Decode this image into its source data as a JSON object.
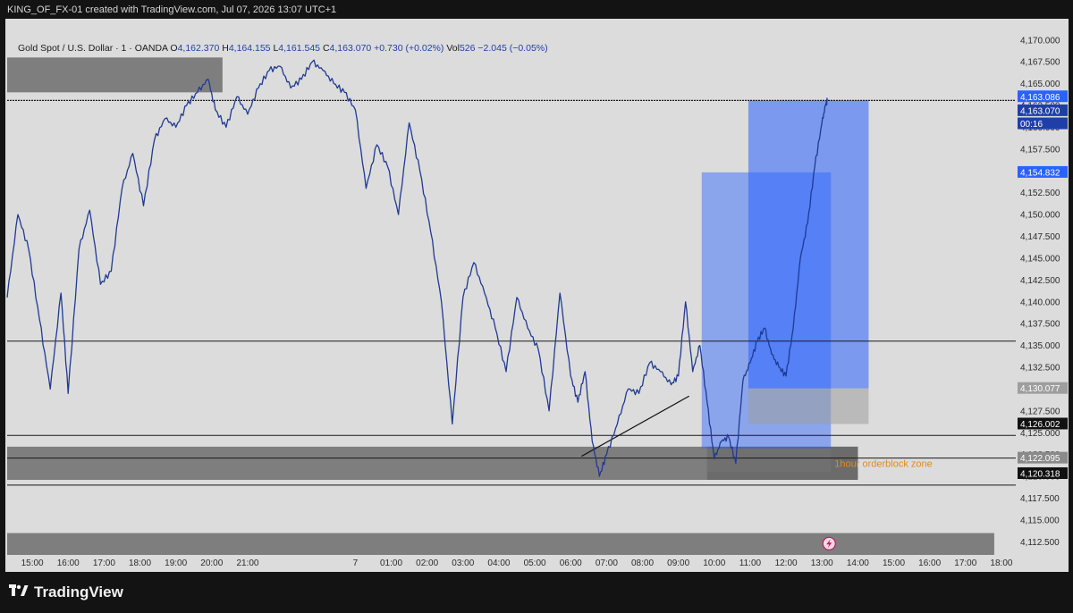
{
  "header": {
    "credit": "KING_OF_FX-01 created with TradingView.com, Jul 07, 2026 13:07 UTC+1"
  },
  "legend": {
    "symbol": "Gold Spot / U.S. Dollar · 1 · OANDA",
    "open_label": "O",
    "open": "4,162.370",
    "high_label": "H",
    "high": "4,164.155",
    "low_label": "L",
    "low": "4,161.545",
    "close_label": "C",
    "close": "4,163.070",
    "change": "+0.730 (+0.02%)",
    "vol_label": "Vol",
    "vol": "526",
    "vol_change": "−2.045 (−0.05%)"
  },
  "footer": {
    "brand": "TradingView",
    "logo_icon": "tradingview-logo-icon"
  },
  "chart_data": {
    "type": "line",
    "title": "",
    "xlabel": "",
    "ylabel": "",
    "ylim": [
      4111.0,
      4171.0
    ],
    "grid": false,
    "y_ticks": [
      "4,170.000",
      "4,167.500",
      "4,165.000",
      "4,162.500",
      "4,160.000",
      "4,157.500",
      "4,155.000",
      "4,152.500",
      "4,150.000",
      "4,147.500",
      "4,145.000",
      "4,142.500",
      "4,140.000",
      "4,137.500",
      "4,135.000",
      "4,132.500",
      "4,130.000",
      "4,127.500",
      "4,125.000",
      "4,122.500",
      "4,120.000",
      "4,117.500",
      "4,115.000",
      "4,112.500"
    ],
    "x_ticks": [
      "15:00",
      "16:00",
      "17:00",
      "18:00",
      "19:00",
      "20:00",
      "21:00",
      "7",
      "01:00",
      "02:00",
      "03:00",
      "04:00",
      "05:00",
      "06:00",
      "07:00",
      "08:00",
      "09:00",
      "10:00",
      "11:00",
      "12:00",
      "13:00",
      "14:00",
      "15:00",
      "16:00",
      "17:00",
      "18:00"
    ],
    "x_tick_hours": [
      15,
      16,
      17,
      18,
      19,
      20,
      21,
      24,
      25,
      26,
      27,
      28,
      29,
      30,
      31,
      32,
      33,
      34,
      35,
      36,
      37,
      38,
      39,
      40,
      41,
      42
    ],
    "series": [
      {
        "color": "#1f3a93",
        "x_hours": [
          14.3,
          14.6,
          14.9,
          15.2,
          15.5,
          15.8,
          16.0,
          16.3,
          16.6,
          16.9,
          17.2,
          17.5,
          17.8,
          18.1,
          18.4,
          18.7,
          19.0,
          19.3,
          19.6,
          19.9,
          20.1,
          20.4,
          20.7,
          21.0,
          21.3,
          21.6,
          21.9,
          22.2,
          22.5,
          22.8,
          23.1,
          23.4,
          23.7,
          24.0,
          24.3,
          24.6,
          24.9,
          25.2,
          25.5,
          25.8,
          26.1,
          26.4,
          26.7,
          27.0,
          27.3,
          27.6,
          27.9,
          28.2,
          28.5,
          28.8,
          29.1,
          29.4,
          29.7,
          30.0,
          30.2,
          30.4,
          30.6,
          30.8,
          31.0,
          31.3,
          31.6,
          31.9,
          32.2,
          32.5,
          32.8,
          33.0,
          33.2,
          33.4,
          33.6,
          33.8,
          34.0,
          34.2,
          34.4,
          34.6,
          34.8,
          35.0,
          35.2,
          35.4,
          35.6,
          35.8,
          36.0,
          36.2,
          36.4,
          36.6,
          36.8,
          37.0,
          37.1,
          37.15
        ],
        "values": [
          4140.5,
          4150.0,
          4146.0,
          4138.0,
          4130.0,
          4141.0,
          4129.5,
          4146.0,
          4150.5,
          4142.0,
          4143.5,
          4153.0,
          4157.0,
          4151.0,
          4158.5,
          4161.0,
          4160.0,
          4162.5,
          4164.0,
          4165.5,
          4162.0,
          4160.0,
          4163.5,
          4161.5,
          4164.5,
          4166.5,
          4167.0,
          4164.5,
          4165.5,
          4167.5,
          4166.5,
          4165.0,
          4164.0,
          4162.0,
          4153.0,
          4158.0,
          4155.5,
          4150.0,
          4160.5,
          4155.0,
          4148.0,
          4140.0,
          4126.0,
          4140.5,
          4144.5,
          4141.0,
          4137.0,
          4132.0,
          4140.5,
          4137.0,
          4134.5,
          4127.5,
          4141.0,
          4131.5,
          4128.5,
          4132.0,
          4124.0,
          4120.0,
          4122.5,
          4126.0,
          4130.0,
          4129.5,
          4133.0,
          4132.0,
          4130.5,
          4131.5,
          4140.0,
          4132.0,
          4135.0,
          4128.5,
          4122.0,
          4124.0,
          4124.5,
          4121.5,
          4131.0,
          4133.0,
          4135.5,
          4137.0,
          4134.0,
          4132.5,
          4131.5,
          4137.0,
          4145.0,
          4149.0,
          4155.5,
          4160.5,
          4162.5,
          4163.07
        ]
      }
    ],
    "hlines": [
      {
        "value": 4163.086
      },
      {
        "value": 4163.07
      },
      {
        "value": 4135.5
      },
      {
        "value": 4124.7
      },
      {
        "value": 4122.1
      },
      {
        "value": 4119.0
      }
    ],
    "price_labels": [
      {
        "text": "4,163.086",
        "value": 4163.5,
        "color": "#2962ff",
        "text_color": "#ffffff"
      },
      {
        "text": "4,163.070",
        "value": 4161.9,
        "color": "#1f3fa8",
        "text_color": "#ffffff"
      },
      {
        "text": "00:16",
        "value": 4160.4,
        "color": "#1f3fa8",
        "text_color": "#ffffff"
      },
      {
        "text": "4,154.832",
        "value": 4154.832,
        "color": "#2962ff",
        "text_color": "#ffffff"
      },
      {
        "text": "4,130.077",
        "value": 4130.077,
        "color": "#9e9e9e",
        "text_color": "#ffffff"
      },
      {
        "text": "4,126.002",
        "value": 4126.002,
        "color": "#111111",
        "text_color": "#ffffff"
      },
      {
        "text": "4,122.095",
        "value": 4122.095,
        "color": "#8a8a8a",
        "text_color": "#ffffff"
      },
      {
        "text": "4,120.318",
        "value": 4120.318,
        "color": "#111111",
        "text_color": "#ffffff"
      }
    ],
    "zones": [
      {
        "x1_hours": 14.3,
        "x2_hours": 20.3,
        "y1": 4168.0,
        "y2": 4164.0,
        "color": "#7e7e7e",
        "opacity": 1.0
      },
      {
        "x1_hours": 14.3,
        "x2_hours": 38.0,
        "y1": 4123.4,
        "y2": 4119.6,
        "color": "#7e7e7e",
        "opacity": 1.0
      },
      {
        "x1_hours": 14.3,
        "x2_hours": 41.8,
        "y1": 4113.5,
        "y2": 4111.0,
        "color": "#7e7e7e",
        "opacity": 1.0
      },
      {
        "x1_hours": 33.8,
        "x2_hours": 38.0,
        "y1": 4123.4,
        "y2": 4119.6,
        "color": "#6b6b6b",
        "opacity": 1.0
      }
    ],
    "zone_labels": [
      {
        "text": "1hour orderblock zone",
        "x_hours": 37.35,
        "value": 4121.5,
        "color": "#e08a1c"
      }
    ],
    "positions": [
      {
        "x1_hours": 33.65,
        "x2_hours": 37.25,
        "entry": 4123.2,
        "target": 4154.832,
        "stop": 4120.5,
        "profit_color": "#2962ff",
        "profit_opacity": 0.45,
        "stop_color": "#7e7e7e",
        "stop_opacity": 0.25
      },
      {
        "x1_hours": 34.95,
        "x2_hours": 38.3,
        "entry": 4130.077,
        "target": 4163.086,
        "stop": 4126.002,
        "profit_color": "#2962ff",
        "profit_opacity": 0.55,
        "stop_color": "#9e9e9e",
        "stop_opacity": 0.55
      }
    ],
    "trendlines": [
      {
        "x1_hours": 30.3,
        "y1": 4122.3,
        "x2_hours": 33.3,
        "y2": 4129.2,
        "color": "#111111"
      }
    ],
    "icons": [
      {
        "name": "lightning-icon",
        "x_hours": 37.2,
        "value": 4112.3,
        "color": "#c2185b"
      }
    ]
  }
}
